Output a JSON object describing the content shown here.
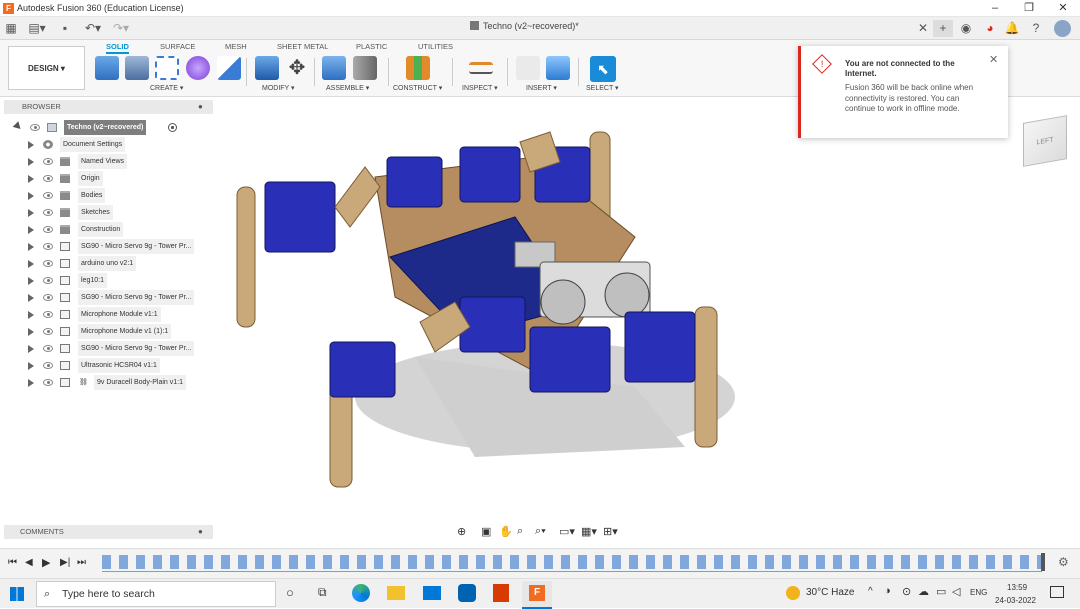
{
  "app": {
    "title": "Autodesk Fusion 360 (Education License)",
    "doc_tab": "Techno (v2~recovered)*"
  },
  "toolbar": {
    "design_label": "DESIGN",
    "tabs": [
      "SOLID",
      "SURFACE",
      "MESH",
      "SHEET METAL",
      "PLASTIC",
      "UTILITIES"
    ],
    "groups": [
      "CREATE",
      "MODIFY",
      "ASSEMBLE",
      "CONSTRUCT",
      "INSPECT",
      "INSERT",
      "SELECT"
    ]
  },
  "browser": {
    "title": "BROWSER",
    "root": "Techno (v2~recovered)",
    "items": [
      {
        "label": "Document Settings"
      },
      {
        "label": "Named Views"
      },
      {
        "label": "Origin"
      },
      {
        "label": "Bodies"
      },
      {
        "label": "Sketches"
      },
      {
        "label": "Construction"
      },
      {
        "label": "SG90 - Micro Servo 9g - Tower Pr..."
      },
      {
        "label": "arduino uno v2:1"
      },
      {
        "label": "leg10:1"
      },
      {
        "label": "SG90 - Micro Servo 9g - Tower Pr..."
      },
      {
        "label": "Microphone Module v1:1"
      },
      {
        "label": "Microphone Module v1 (1):1"
      },
      {
        "label": "SG90 - Micro Servo 9g - Tower Pr..."
      },
      {
        "label": "Ultrasonic HCSR04 v1:1"
      },
      {
        "label": "9v Duracell Body-Plain v1:1"
      }
    ]
  },
  "comments": {
    "label": "COMMENTS"
  },
  "viewcube": {
    "face": "LEFT"
  },
  "notification": {
    "title": "You are not connected to the Internet.",
    "body": "Fusion 360 will be back online when connectivity is restored. You can continue to work in offline mode."
  },
  "taskbar": {
    "search_placeholder": "Type here to search",
    "weather": "30°C  Haze",
    "language": "ENG",
    "time": "13:59",
    "date": "24-03-2022"
  },
  "colors": {
    "accent": "#0696d7",
    "servo": "#2a2fb8",
    "board": "#1e2a8a",
    "wood": "#c9a97a",
    "error": "#d9281d"
  }
}
